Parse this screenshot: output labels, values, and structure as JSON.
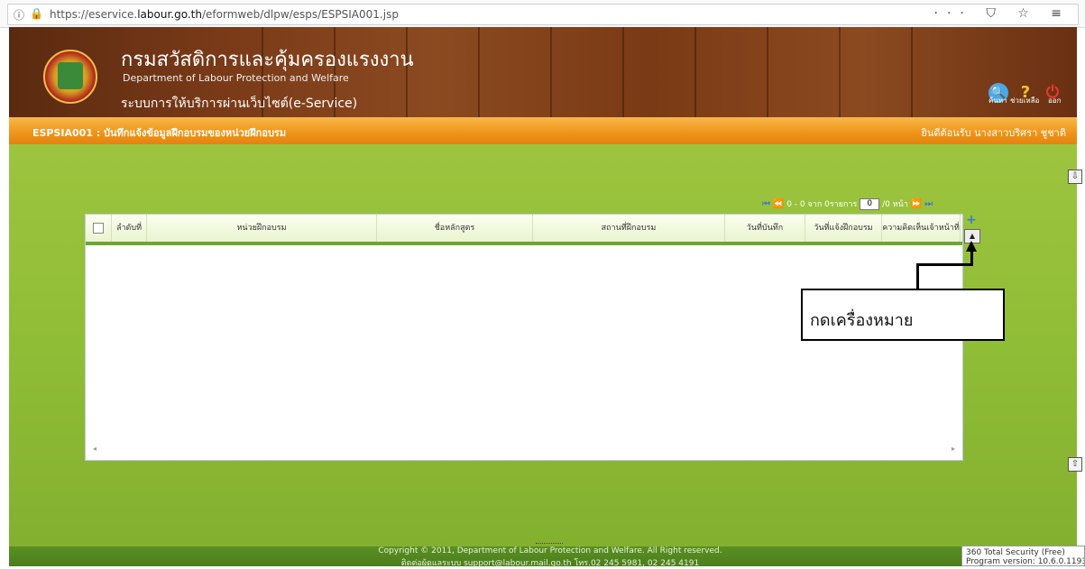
{
  "browser": {
    "url_prefix": "https://eservice.",
    "url_domain": "labour.go.th",
    "url_path": "/eformweb/dlpw/esps/ESPSIA001.jsp",
    "info_icon": "ⓘ",
    "lock_icon": "🔒",
    "right_icons": "··· ⛉ ☆ ≡"
  },
  "header": {
    "org_th": "กรมสวัสดิการและคุ้มครองแรงงาน",
    "org_en": "Department of Labour Protection and Welfare",
    "system": "ระบบการให้บริการผ่านเว็บไซต์(e-Service)",
    "search_label": "ค้นหา",
    "help_label": "ช่วยเหลือ",
    "logout_label": "ออก"
  },
  "titlebar": {
    "screen": "ESPSIA001 : บันทึกแจ้งข้อมูลฝึกอบรมของหน่วยฝึกอบรม",
    "welcome": "ยินดีต้อนรับ นางสาวบริศรา ชูชาติ"
  },
  "pager": {
    "range": "0 - 0 จาก 0รายการ",
    "page_value": "0",
    "pages": "/0 หน้า"
  },
  "grid": {
    "columns": [
      "ลำดับที่",
      "หน่วยฝึกอบรม",
      "ชื่อหลักสูตร",
      "สถานที่ฝึกอบรม",
      "วันที่บันทึก",
      "วันที่แจ้งฝึกอบรม",
      "ความคิดเห็นเจ้าหน้าที่"
    ],
    "add_symbol": "+",
    "sort_symbol": "▲"
  },
  "callout": {
    "text": "กดเครื่องหมาย"
  },
  "footer": {
    "copyright": "Copyright © 2011, Department of Labour Protection and Welfare. All Right reserved.",
    "contact": "ติดต่อผู้ดูแลระบบ support@labour.mail.go.th โทร.02 245 5981, 02 245 4191"
  },
  "security": {
    "line1": "360 Total Security (Free)",
    "line2": "Program version: 10.6.0.1193"
  }
}
